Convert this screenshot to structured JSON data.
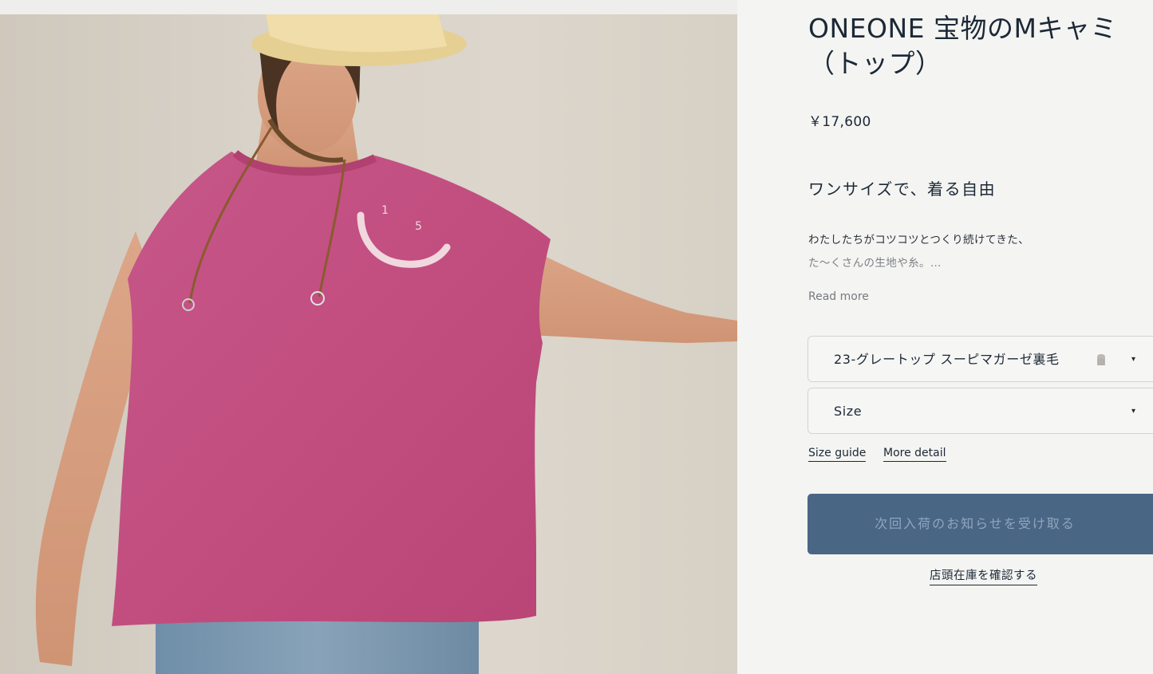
{
  "product": {
    "title_line1": "ONEONE 宝物のMキャミ",
    "title_line2": "（トップ）",
    "price": "￥17,600",
    "tagline": "ワンサイズで、着る自由",
    "description_line1": "わたしたちがコツコツとつくり続けてきた、",
    "description_line2": "た～くさんの生地や糸。…",
    "read_more": "Read more"
  },
  "options": {
    "color_selected": "23-グレートップ スーピマガーゼ裏毛",
    "size_label": "Size",
    "caret": "▾"
  },
  "links": {
    "size_guide": "Size guide",
    "more_detail": "More detail"
  },
  "actions": {
    "notify_button": "次回入荷のお知らせを受け取る",
    "check_store_stock": "店頭在庫を確認する"
  },
  "colors": {
    "text": "#1b2836",
    "button": "#4a6685",
    "button_text": "#8fa5bd",
    "shirt": "#c4507e",
    "swatch": "#bdbab4"
  },
  "photo": {
    "logo_text_left": "1",
    "logo_text_right": "5"
  }
}
